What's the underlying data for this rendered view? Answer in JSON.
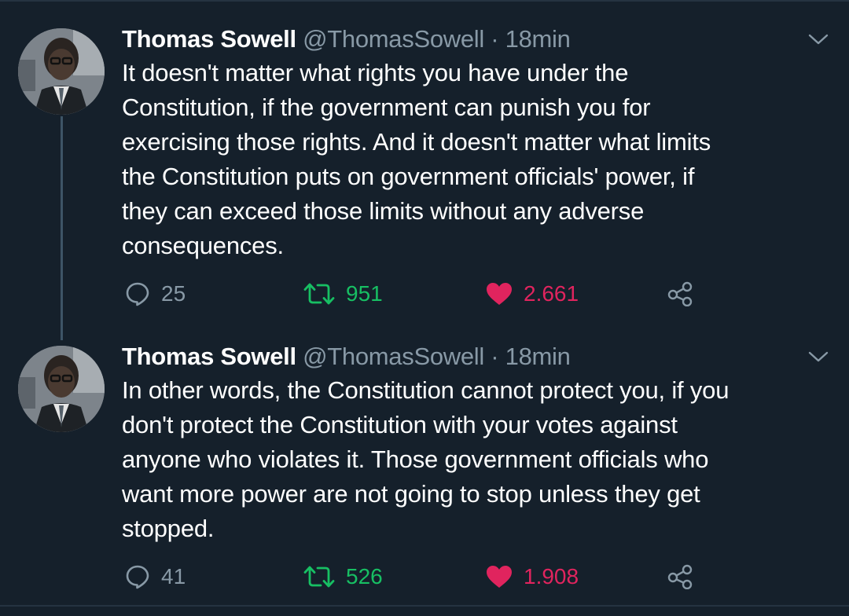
{
  "tweets": [
    {
      "author_name": "Thomas Sowell",
      "handle": "@ThomasSowell",
      "separator": "·",
      "time": "18min",
      "text_lines": [
        "It doesn't matter what rights you have under the",
        "Constitution, if the government can punish you for",
        "exercising those rights. And it doesn't matter what limits",
        "the Constitution puts on government officials' power, if",
        "they can exceed those limits without any adverse",
        "consequences."
      ],
      "replies": "25",
      "retweets": "951",
      "likes": "2.661",
      "liked": true
    },
    {
      "author_name": "Thomas Sowell",
      "handle": "@ThomasSowell",
      "separator": "·",
      "time": "18min",
      "text_lines": [
        "In other words, the Constitution cannot protect you, if you",
        "don't protect the Constitution with your votes against",
        "anyone who violates it. Those government officials who",
        "want more power are not going to stop unless they get",
        "stopped."
      ],
      "replies": "41",
      "retweets": "526",
      "likes": "1.908",
      "liked": true
    }
  ],
  "icons": {
    "reply": "reply-bubble-icon",
    "retweet": "retweet-icon",
    "like": "heart-filled-icon",
    "share": "share-icon",
    "more": "chevron-down-icon"
  },
  "colors": {
    "background": "#15202b",
    "secondary_text": "#8899a6",
    "retweet_green": "#17bf63",
    "like_pink": "#e0245e",
    "divider": "#253341",
    "thread_line": "#3d5466"
  }
}
